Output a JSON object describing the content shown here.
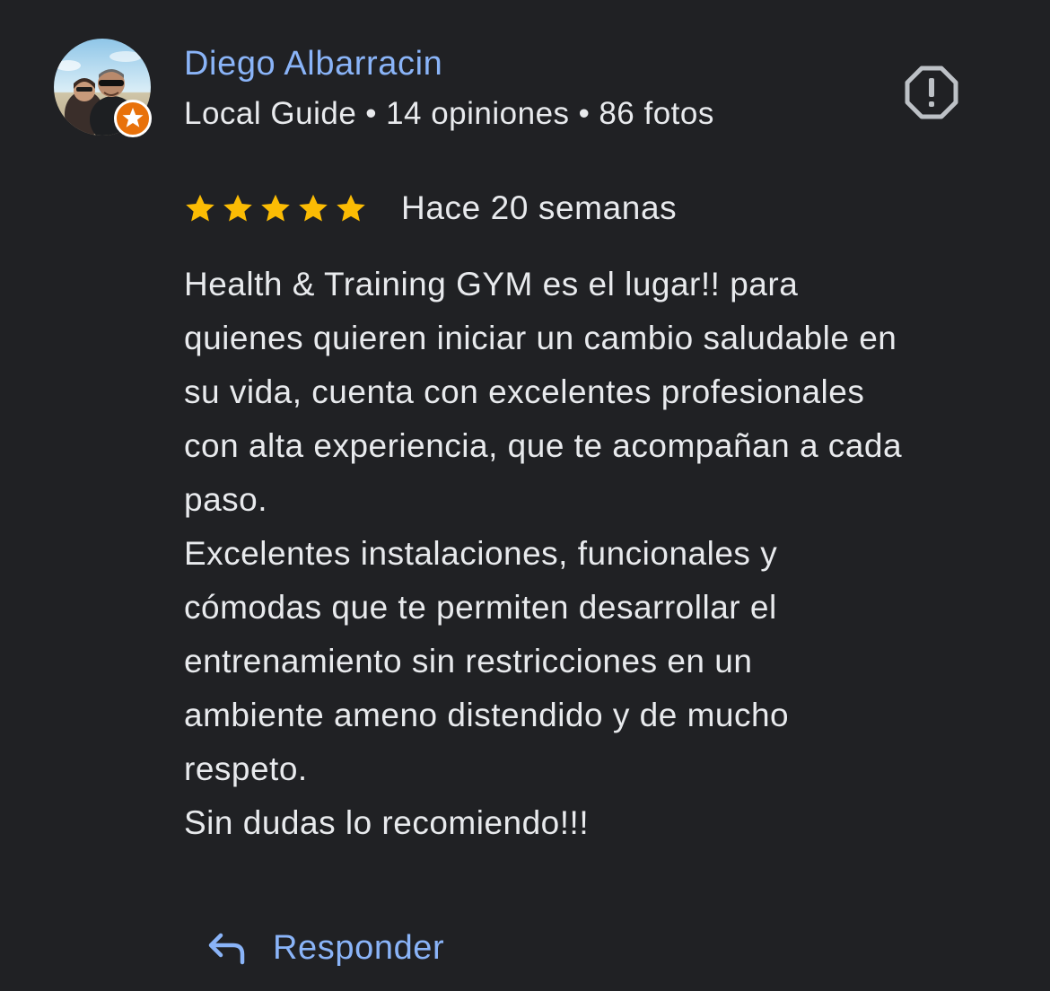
{
  "review": {
    "author": {
      "name": "Diego Albarracin",
      "badge": "Local Guide",
      "reviews_count": "14 opiniones",
      "photos_count": "86 fotos",
      "separator": "•",
      "avatar_icon": "user-avatar-photo",
      "badge_icon": "local-guide-star-badge"
    },
    "rating": {
      "stars": 5,
      "max_stars": 5,
      "star_color": "#fbbc04"
    },
    "date": "Hace 20 semanas",
    "text_lines": [
      "Health & Training GYM es el lugar!! para",
      "quienes quieren iniciar un cambio saludable en",
      "su vida, cuenta con excelentes profesionales",
      "con alta experiencia, que te acompañan a cada",
      "paso.",
      "Excelentes instalaciones, funcionales y",
      "cómodas que te permiten desarrollar el",
      "entrenamiento sin restricciones en un",
      "ambiente ameno distendido y de mucho",
      "respeto.",
      "Sin dudas lo recomiendo!!!"
    ],
    "actions": {
      "reply_label": "Responder",
      "reply_icon": "reply-arrow-icon",
      "report_icon": "report-flag-icon"
    }
  },
  "colors": {
    "background": "#202124",
    "text": "#e8eaed",
    "link": "#8ab4f8",
    "star": "#fbbc04",
    "badge": "#e8710a",
    "icon": "#bdc1c6"
  }
}
